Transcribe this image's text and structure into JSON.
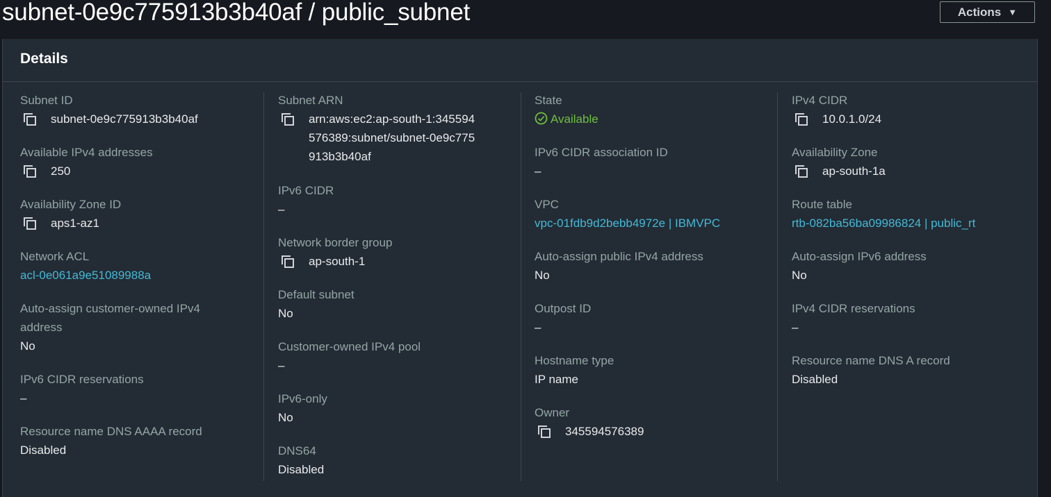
{
  "header": {
    "title": "subnet-0e9c775913b3b40af / public_subnet",
    "actions_label": "Actions",
    "actions_caret": "▼"
  },
  "panel": {
    "title": "Details"
  },
  "columns": [
    [
      {
        "label": "Subnet ID",
        "value": "subnet-0e9c775913b3b40af",
        "copy": true
      },
      {
        "label": "Available IPv4 addresses",
        "value": "250",
        "copy": true
      },
      {
        "label": "Availability Zone ID",
        "value": "aps1-az1",
        "copy": true
      },
      {
        "label": "Network ACL",
        "value": "acl-0e061a9e51089988a",
        "link": true
      },
      {
        "label": "Auto-assign customer-owned IPv4 address",
        "value": "No"
      },
      {
        "label": "IPv6 CIDR reservations",
        "value": "–"
      },
      {
        "label": "Resource name DNS AAAA record",
        "value": "Disabled"
      }
    ],
    [
      {
        "label": "Subnet ARN",
        "value": "arn:aws:ec2:ap-south-1:345594576389:subnet/subnet-0e9c775913b3b40af",
        "copy": true
      },
      {
        "label": "IPv6 CIDR",
        "value": "–"
      },
      {
        "label": "Network border group",
        "value": "ap-south-1",
        "copy": true
      },
      {
        "label": "Default subnet",
        "value": "No"
      },
      {
        "label": "Customer-owned IPv4 pool",
        "value": "–"
      },
      {
        "label": "IPv6-only",
        "value": "No"
      },
      {
        "label": "DNS64",
        "value": "Disabled"
      }
    ],
    [
      {
        "label": "State",
        "value": "Available",
        "status": "available"
      },
      {
        "label": "IPv6 CIDR association ID",
        "value": "–"
      },
      {
        "label": "VPC",
        "value": "vpc-01fdb9d2bebb4972e | IBMVPC",
        "link": true
      },
      {
        "label": "Auto-assign public IPv4 address",
        "value": "No"
      },
      {
        "label": "Outpost ID",
        "value": "–"
      },
      {
        "label": "Hostname type",
        "value": "IP name"
      },
      {
        "label": "Owner",
        "value": "345594576389",
        "copy": true
      }
    ],
    [
      {
        "label": "IPv4 CIDR",
        "value": "10.0.1.0/24",
        "copy": true
      },
      {
        "label": "Availability Zone",
        "value": "ap-south-1a",
        "copy": true
      },
      {
        "label": "Route table",
        "value": "rtb-082ba56ba09986824 | public_rt",
        "link": true
      },
      {
        "label": "Auto-assign IPv6 address",
        "value": "No"
      },
      {
        "label": "IPv4 CIDR reservations",
        "value": "–"
      },
      {
        "label": "Resource name DNS A record",
        "value": "Disabled"
      }
    ]
  ],
  "colors": {
    "link": "#44b9d6",
    "available": "#6fbf40",
    "background": "#16191f",
    "panel": "#232b34"
  },
  "icons": {
    "copy": "copy-icon",
    "status": "check-circle-icon",
    "caret": "caret-down-icon"
  }
}
